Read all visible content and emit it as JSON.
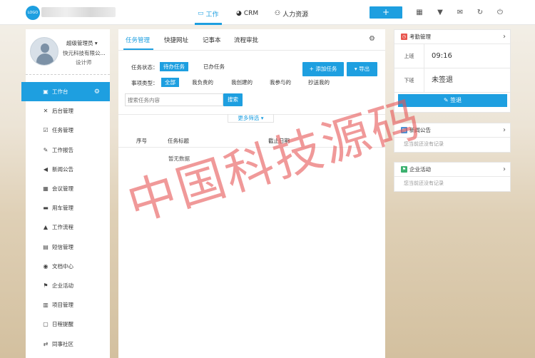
{
  "header": {
    "logo": "LOGO",
    "nav": [
      {
        "label": "工作",
        "icon": "briefcase-icon",
        "active": true
      },
      {
        "label": "CRM",
        "icon": "pie-chart-icon",
        "active": false
      },
      {
        "label": "人力资源",
        "icon": "users-icon",
        "active": false
      }
    ],
    "plus": "+",
    "icons": [
      "grid-icon",
      "shirt-icon",
      "mail-icon",
      "refresh-icon",
      "power-icon"
    ]
  },
  "sidebar": {
    "user_name": "超级管理员 ▾",
    "company": "快元科技有限公...",
    "title": "设计师",
    "items": [
      {
        "label": "工作台",
        "icon": "desktop-icon",
        "glyph": "▣"
      },
      {
        "label": "后台管理",
        "icon": "wrench-icon",
        "glyph": "✕"
      },
      {
        "label": "任务管理",
        "icon": "checkbox-icon",
        "glyph": "☑"
      },
      {
        "label": "工作报告",
        "icon": "edit-icon",
        "glyph": "✎"
      },
      {
        "label": "新闻公告",
        "icon": "bullhorn-icon",
        "glyph": "◀"
      },
      {
        "label": "会议管理",
        "icon": "sitemap-icon",
        "glyph": "▦"
      },
      {
        "label": "用车管理",
        "icon": "car-icon",
        "glyph": "▬"
      },
      {
        "label": "工作流程",
        "icon": "flow-icon",
        "glyph": "▲"
      },
      {
        "label": "短信管理",
        "icon": "message-icon",
        "glyph": "▤"
      },
      {
        "label": "文档中心",
        "icon": "globe-icon",
        "glyph": "◉"
      },
      {
        "label": "企业活动",
        "icon": "flag-icon",
        "glyph": "⚑"
      },
      {
        "label": "项目管理",
        "icon": "project-icon",
        "glyph": "▥"
      },
      {
        "label": "日程提醒",
        "icon": "calendar-icon",
        "glyph": "▢"
      },
      {
        "label": "同事社区",
        "icon": "chat-icon",
        "glyph": "⇄"
      }
    ]
  },
  "main": {
    "tabs": [
      {
        "label": "任务管理",
        "active": true
      },
      {
        "label": "快捷网址",
        "active": false
      },
      {
        "label": "记事本",
        "active": false
      },
      {
        "label": "流程审批",
        "active": false
      }
    ],
    "status_label": "任务状态：",
    "status_options": [
      "待办任务",
      "已办任务"
    ],
    "type_label": "事项类型：",
    "type_options": [
      "全部",
      "我负责的",
      "我创建的",
      "我参与的",
      "抄送我的"
    ],
    "add_button": "+ 添加任务",
    "export_button": "▾ 导出",
    "search_placeholder": "搜索任务内容",
    "search_button": "搜索",
    "more_filter": "更多筛选 ▾",
    "columns": [
      "序号",
      "任务标题",
      "截止日期"
    ],
    "empty_text": "暂无数据"
  },
  "attendance": {
    "title": "考勤管理",
    "clock_in_label": "上班",
    "clock_in_time": "09:16",
    "clock_out_label": "下班",
    "clock_out_status": "未签退",
    "signout_button": "✎ 签退"
  },
  "news": {
    "title": "新闻公告",
    "empty": "您当前还没有记录"
  },
  "activity": {
    "title": "企业活动",
    "empty": "您当前还没有记录"
  },
  "watermark": "中国科技源码",
  "colors": {
    "accent": "#1e9fe0",
    "attendance_icon": "#e8554e",
    "news_icon": "#4a8fd4",
    "activity_icon": "#3bb16f",
    "watermark": "#e65555"
  }
}
